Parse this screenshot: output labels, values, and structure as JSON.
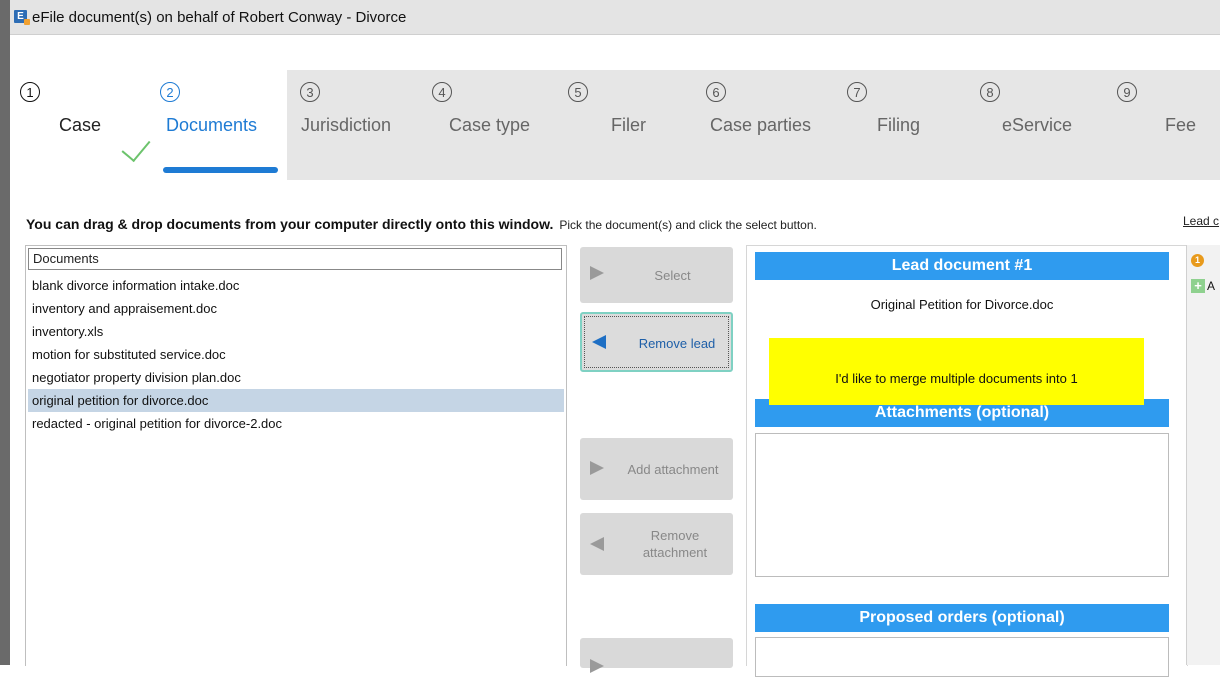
{
  "window": {
    "title": "eFile document(s) on behalf of Robert Conway - Divorce",
    "icon": "app-icon"
  },
  "steps": [
    {
      "num": "1",
      "label": "Case",
      "state": "done"
    },
    {
      "num": "2",
      "label": "Documents",
      "state": "active"
    },
    {
      "num": "3",
      "label": "Jurisdiction",
      "state": "pending"
    },
    {
      "num": "4",
      "label": "Case type",
      "state": "pending"
    },
    {
      "num": "5",
      "label": "Filer",
      "state": "pending"
    },
    {
      "num": "6",
      "label": "Case parties",
      "state": "pending"
    },
    {
      "num": "7",
      "label": "Filing",
      "state": "pending"
    },
    {
      "num": "8",
      "label": "eService",
      "state": "pending"
    },
    {
      "num": "9",
      "label": "Fee",
      "state": "pending"
    }
  ],
  "instruction": {
    "bold": "You can drag & drop documents from your computer directly onto this window.",
    "sub": "Pick the document(s) and click the select button.",
    "right_link": "Lead c"
  },
  "documents": {
    "header": "Documents",
    "items": [
      "blank divorce information intake.doc",
      "inventory and appraisement.doc",
      "inventory.xls",
      "motion for substituted service.doc",
      "negotiator property division plan.doc",
      "original petition for divorce.doc",
      "redacted  - original petition for divorce-2.doc"
    ],
    "selected_index": 5
  },
  "buttons": {
    "select": "Select",
    "remove_lead": "Remove lead",
    "add_attachment": "Add attachment",
    "remove_attachment_line1": "Remove",
    "remove_attachment_line2": "attachment"
  },
  "right": {
    "lead_header": "Lead document #1",
    "lead_doc": "Original Petition for Divorce.doc",
    "attachments_header": "Attachments (optional)",
    "orders_header": "Proposed orders (optional)",
    "note": "I'd like to merge multiple documents into 1",
    "side_badge": "1",
    "side_label": "A"
  },
  "colors": {
    "accent": "#1e7bd4",
    "header_blue": "#2f9bef",
    "note_yellow": "#ffff00",
    "selected_row": "#c5d5e5"
  }
}
